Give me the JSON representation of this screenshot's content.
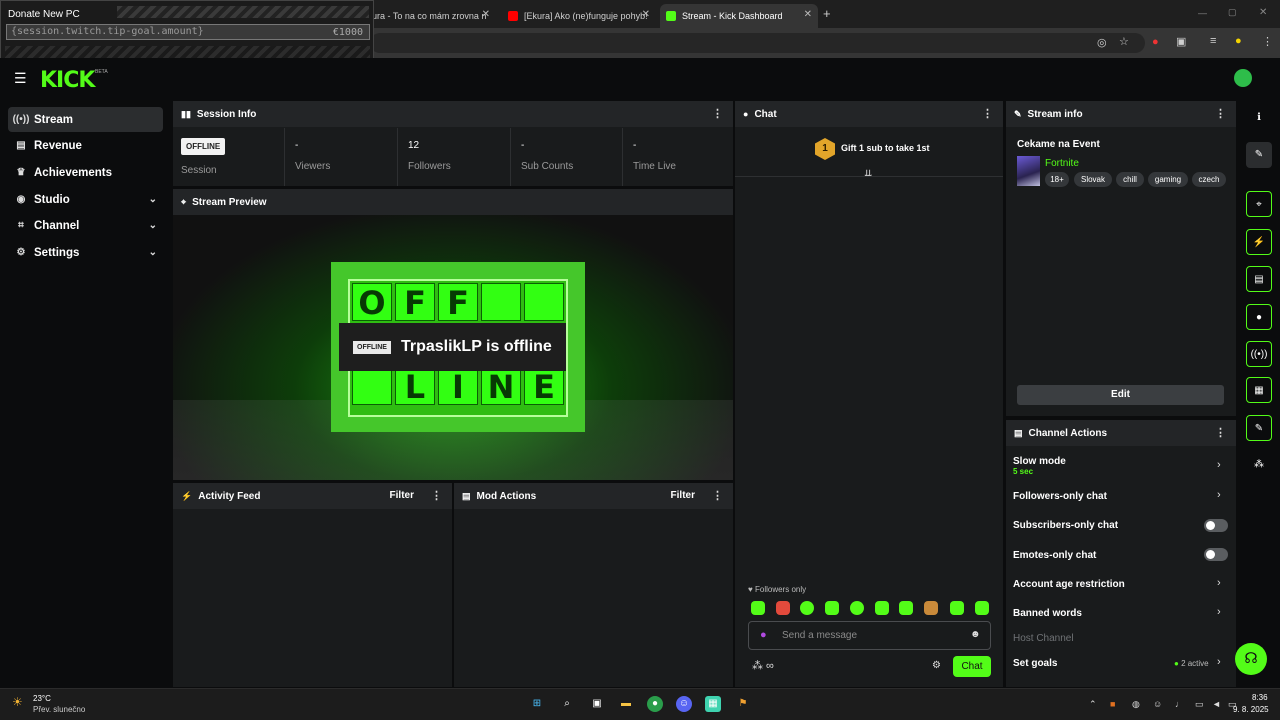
{
  "browser": {
    "tabs": [
      {
        "title": "ura - To na co mám zrovna n",
        "active": false
      },
      {
        "title": "[Ekura] Ako (ne)funguje pohyb!",
        "active": false
      },
      {
        "title": "Stream - Kick Dashboard",
        "active": true
      }
    ],
    "new_tab": "+",
    "window_controls": [
      "—",
      "▢",
      "✕"
    ]
  },
  "overlay": {
    "title": "Donate New PC",
    "input_value": "{session.twitch.tip-goal.amount}",
    "amount": "€1000"
  },
  "app": {
    "logo": "KICK",
    "beta": "BETA",
    "accent": "#53fc18"
  },
  "sidebar": {
    "items": [
      {
        "label": "Stream",
        "icon": "broadcast-icon",
        "active": true,
        "expandable": false
      },
      {
        "label": "Revenue",
        "icon": "wallet-icon",
        "active": false,
        "expandable": false
      },
      {
        "label": "Achievements",
        "icon": "trophy-icon",
        "active": false,
        "expandable": false
      },
      {
        "label": "Studio",
        "icon": "studio-icon",
        "active": false,
        "expandable": true
      },
      {
        "label": "Channel",
        "icon": "channel-icon",
        "active": false,
        "expandable": true
      },
      {
        "label": "Settings",
        "icon": "gear-icon",
        "active": false,
        "expandable": true
      }
    ]
  },
  "session": {
    "title": "Session Info",
    "status_badge": "OFFLINE",
    "stats": [
      {
        "label": "Session",
        "value": ""
      },
      {
        "label": "Viewers",
        "value": "-"
      },
      {
        "label": "Followers",
        "value": "12"
      },
      {
        "label": "Sub Counts",
        "value": "-"
      },
      {
        "label": "Time Live",
        "value": "-"
      }
    ]
  },
  "preview": {
    "title": "Stream Preview",
    "board_letters": [
      "O",
      "F",
      "F",
      "",
      "",
      "L",
      "I",
      "N",
      "E"
    ],
    "badge": "OFFLINE",
    "message": "TrpaslikLP is offline"
  },
  "activity": {
    "title": "Activity Feed",
    "filter": "Filter"
  },
  "mod": {
    "title": "Mod Actions",
    "filter": "Filter"
  },
  "chat": {
    "title": "Chat",
    "gift_rank": "1",
    "gift_text": "Gift 1 sub to take 1st",
    "mode_label": "Followers only",
    "input_placeholder": "Send a message",
    "send_label": "Chat",
    "emote_count": 10
  },
  "stream_info": {
    "title": "Stream info",
    "stream_title": "Cekame na Event",
    "category": "Fortnite",
    "tags": [
      "18+",
      "Slovak",
      "chill",
      "gaming",
      "czech"
    ],
    "edit_label": "Edit"
  },
  "channel_actions": {
    "title": "Channel Actions",
    "slow_mode": {
      "label": "Slow mode",
      "value": "5 sec"
    },
    "followers_only": "Followers-only chat",
    "subscribers_only": {
      "label": "Subscribers-only chat",
      "enabled": false
    },
    "emotes_only": {
      "label": "Emotes-only chat",
      "enabled": false
    },
    "account_age": "Account age restriction",
    "banned_words": "Banned words",
    "host_channel": "Host Channel",
    "set_goals": {
      "label": "Set goals",
      "status": "2 active"
    }
  },
  "taskbar": {
    "weather_temp": "23°C",
    "weather_desc": "Přev. slunečno",
    "time": "8:36",
    "date": "9. 8. 2025"
  }
}
